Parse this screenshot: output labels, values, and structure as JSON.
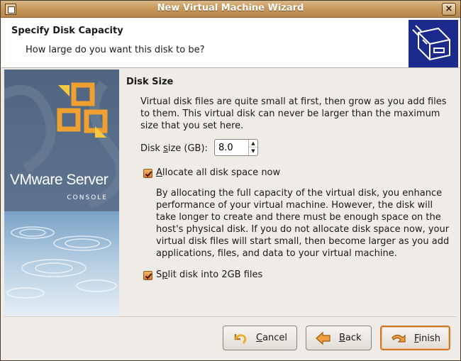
{
  "window": {
    "title": "New Virtual Machine Wizard",
    "close_glyph": "×"
  },
  "header": {
    "title": "Specify Disk Capacity",
    "subtitle": "How large do you want this disk to be?",
    "icon": "hard-disk-icon"
  },
  "banner": {
    "brand": "VMware Server",
    "brand_sub": "CONSOLE"
  },
  "disk_size": {
    "section_title": "Disk Size",
    "intro": "Virtual disk files are quite small at first, then grow as you add files to them. This virtual disk can never be larger than the maximum size that you set here.",
    "size_label_pre": "Disk ",
    "size_label_u": "s",
    "size_label_post": "ize (GB):",
    "size_value": "8.0",
    "allocate": {
      "checked": true,
      "label_u": "A",
      "label_rest": "llocate all disk space now"
    },
    "allocate_description": "By allocating the full capacity of the virtual disk, you enhance performance of your virtual machine. However, the disk will take longer to create and there must be enough space on the host's physical disk. If you do not allocate disk space now, your virtual disk files will start small, then become larger as you add applications, files, and data to your virtual machine.",
    "split": {
      "checked": true,
      "label_pre": "S",
      "label_u": "p",
      "label_rest": "lit disk into 2GB files"
    }
  },
  "buttons": {
    "cancel": {
      "u": "C",
      "rest": "ancel",
      "icon": "undo-arrow-icon"
    },
    "back": {
      "u": "B",
      "rest": "ack",
      "icon": "left-arrow-icon"
    },
    "finish": {
      "u": "F",
      "rest": "inish",
      "icon": "finish-arrow-icon"
    }
  },
  "colors": {
    "accent": "#c9782e",
    "titlebar": "#c8995c",
    "header_icon_bg": "#1c2a8c"
  }
}
